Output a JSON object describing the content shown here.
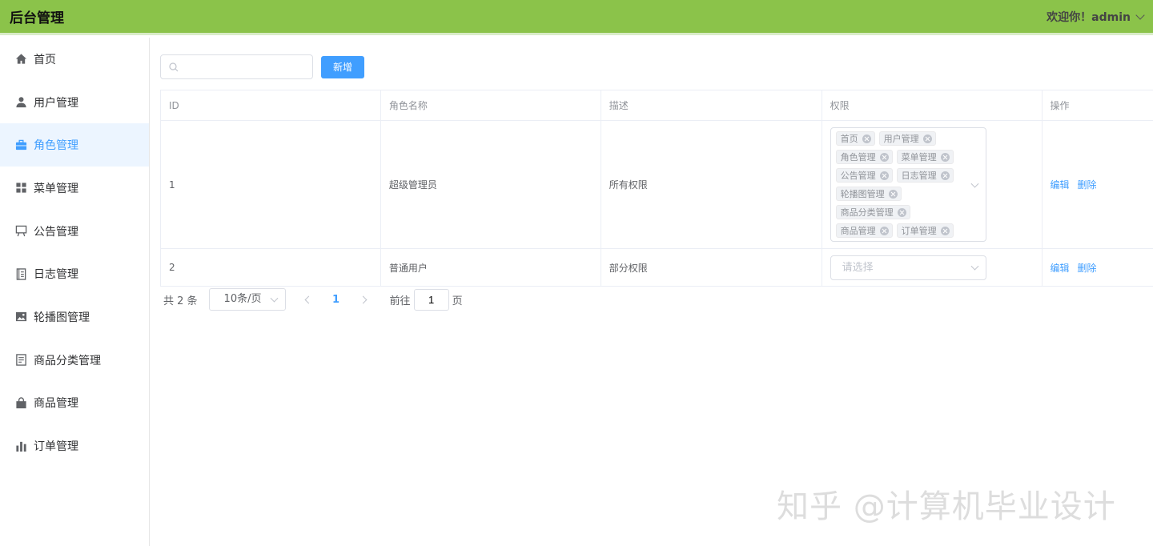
{
  "header": {
    "brand": "后台管理",
    "greeting": "欢迎你！admin"
  },
  "sidebar": {
    "items": [
      {
        "label": "首页",
        "icon": "home-icon"
      },
      {
        "label": "用户管理",
        "icon": "user-icon"
      },
      {
        "label": "角色管理",
        "icon": "briefcase-icon",
        "active": true
      },
      {
        "label": "菜单管理",
        "icon": "grid-icon"
      },
      {
        "label": "公告管理",
        "icon": "easel-icon"
      },
      {
        "label": "日志管理",
        "icon": "notebook-icon"
      },
      {
        "label": "轮播图管理",
        "icon": "picture-icon"
      },
      {
        "label": "商品分类管理",
        "icon": "document-icon"
      },
      {
        "label": "商品管理",
        "icon": "shopping-bag-icon"
      },
      {
        "label": "订单管理",
        "icon": "bar-chart-icon"
      }
    ]
  },
  "toolbar": {
    "search_value": "",
    "add_label": "新增"
  },
  "table": {
    "columns": [
      "ID",
      "角色名称",
      "描述",
      "权限",
      "操作"
    ],
    "rows": [
      {
        "id": "1",
        "name": "超级管理员",
        "desc": "所有权限",
        "permissions": [
          "首页",
          "用户管理",
          "角色管理",
          "菜单管理",
          "公告管理",
          "日志管理",
          "轮播图管理",
          "商品分类管理",
          "商品管理",
          "订单管理"
        ],
        "edit": "编辑",
        "delete": "删除"
      },
      {
        "id": "2",
        "name": "普通用户",
        "desc": "部分权限",
        "placeholder": "请选择",
        "edit": "编辑",
        "delete": "删除"
      }
    ]
  },
  "pager": {
    "total": "共 2 条",
    "page_size": "10条/页",
    "current": "1",
    "goto_prefix": "前往",
    "goto_value": "1",
    "goto_suffix": "页"
  },
  "watermark": "知乎 @计算机毕业设计",
  "colors": {
    "header_bg": "#8bc34a",
    "primary": "#409eff",
    "active_bg": "#ecf5ff"
  }
}
